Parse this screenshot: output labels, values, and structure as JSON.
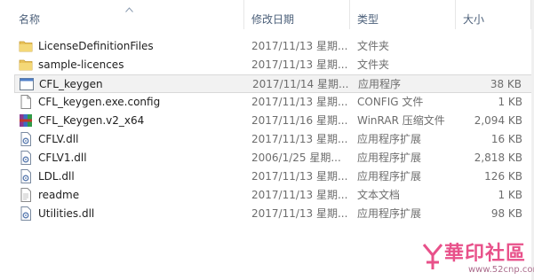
{
  "columns": {
    "name": "名称",
    "date": "修改日期",
    "type": "类型",
    "size": "大小"
  },
  "files": [
    {
      "name": "LicenseDefinitionFiles",
      "date": "2017/11/13 星期...",
      "type": "文件夹",
      "size": "",
      "icon": "folder-icon"
    },
    {
      "name": "sample-licences",
      "date": "2017/11/13 星期...",
      "type": "文件夹",
      "size": "",
      "icon": "folder-icon"
    },
    {
      "name": "CFL_keygen",
      "date": "2017/11/14 星期...",
      "type": "应用程序",
      "size": "38 KB",
      "icon": "application-icon",
      "selected": true
    },
    {
      "name": "CFL_keygen.exe.config",
      "date": "2017/11/13 星期...",
      "type": "CONFIG 文件",
      "size": "1 KB",
      "icon": "config-file-icon"
    },
    {
      "name": "CFL_Keygen.v2_x64",
      "date": "2017/11/16 星期...",
      "type": "WinRAR 压缩文件",
      "size": "2,094 KB",
      "icon": "winrar-archive-icon"
    },
    {
      "name": "CFLV.dll",
      "date": "2017/11/13 星期...",
      "type": "应用程序扩展",
      "size": "16 KB",
      "icon": "dll-file-icon"
    },
    {
      "name": "CFLV1.dll",
      "date": "2006/1/25 星期...",
      "type": "应用程序扩展",
      "size": "2,818 KB",
      "icon": "dll-file-icon"
    },
    {
      "name": "LDL.dll",
      "date": "2017/11/13 星期...",
      "type": "应用程序扩展",
      "size": "126 KB",
      "icon": "dll-file-icon"
    },
    {
      "name": "readme",
      "date": "2017/11/13 星期...",
      "type": "文本文档",
      "size": "1 KB",
      "icon": "text-file-icon"
    },
    {
      "name": "Utilities.dll",
      "date": "2017/11/13 星期...",
      "type": "应用程序扩展",
      "size": "98 KB",
      "icon": "dll-file-icon"
    }
  ],
  "watermark": {
    "name": "華印社區",
    "url": "www.52cnp.com"
  }
}
